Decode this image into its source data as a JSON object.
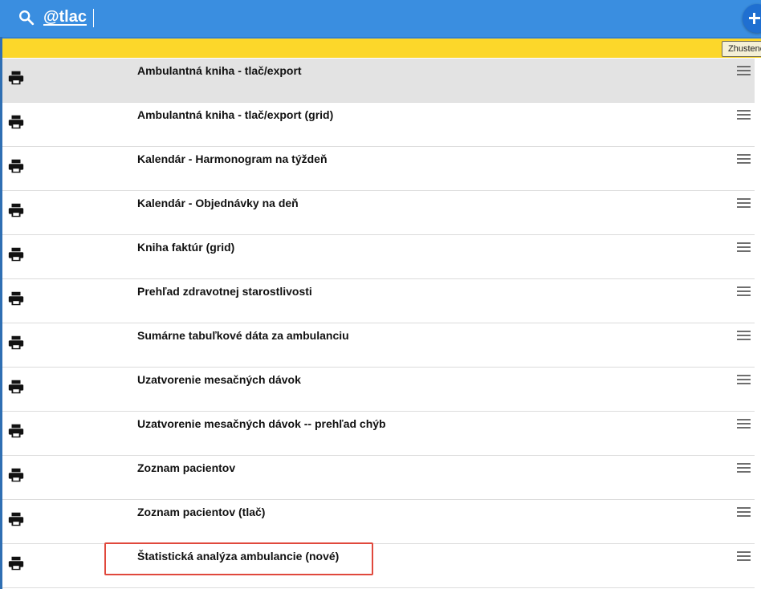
{
  "search": {
    "value": "@tlac"
  },
  "toolbar": {
    "compact_label": "Zhustené"
  },
  "colors": {
    "header": "#3a8ee0",
    "toolbar": "#fcd72a",
    "highlight": "#e0483c",
    "selected_row": "#e3e3e3"
  },
  "rows": [
    {
      "label": "Ambulantná kniha - tlač/export",
      "icon": "printer-icon"
    },
    {
      "label": "Ambulantná kniha - tlač/export (grid)",
      "icon": "printer-icon"
    },
    {
      "label": "Kalendár - Harmonogram na týždeň",
      "icon": "printer-icon"
    },
    {
      "label": "Kalendár - Objednávky na deň",
      "icon": "printer-icon"
    },
    {
      "label": "Kniha faktúr (grid)",
      "icon": "printer-icon"
    },
    {
      "label": "Prehľad zdravotnej starostlivosti",
      "icon": "printer-icon"
    },
    {
      "label": "Sumárne tabuľkové dáta za ambulanciu",
      "icon": "printer-icon"
    },
    {
      "label": "Uzatvorenie mesačných dávok",
      "icon": "printer-icon"
    },
    {
      "label": "Uzatvorenie mesačných dávok -- prehľad chýb",
      "icon": "printer-icon"
    },
    {
      "label": "Zoznam pacientov",
      "icon": "printer-icon"
    },
    {
      "label": "Zoznam pacientov (tlač)",
      "icon": "printer-icon"
    },
    {
      "label": "Štatistická analýza ambulancie (nové)",
      "icon": "printer-icon"
    }
  ]
}
